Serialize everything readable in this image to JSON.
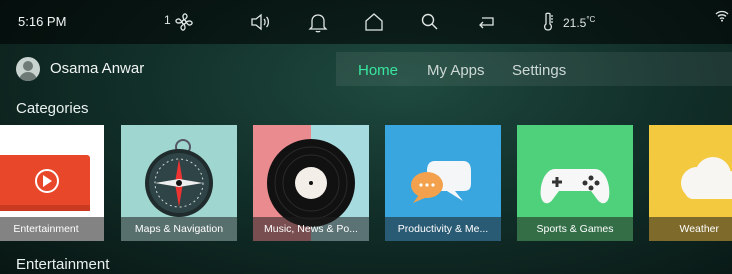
{
  "status_bar": {
    "time": "5:16 PM",
    "fan_level": "1",
    "temperature": "21.5",
    "temperature_unit": "°C",
    "icons": [
      "fan-icon",
      "volume-icon",
      "bell-icon",
      "home-icon",
      "search-icon",
      "return-icon",
      "thermometer-icon",
      "wifi-icon"
    ]
  },
  "user": {
    "name": "Osama  Anwar"
  },
  "nav": {
    "tabs": [
      {
        "label": "Home",
        "active": true
      },
      {
        "label": "My Apps",
        "active": false
      },
      {
        "label": "Settings",
        "active": false
      }
    ]
  },
  "categories": {
    "title": "Categories",
    "items": [
      {
        "label": "Entertainment",
        "bg": "#ffffff",
        "icon": "play-icon"
      },
      {
        "label": "Maps & Navigation",
        "bg": "#9fd6cf",
        "icon": "compass-icon"
      },
      {
        "label": "Music, News & Po...",
        "bg": "#e98b8f",
        "icon": "vinyl-record-icon"
      },
      {
        "label": "Productivity & Me...",
        "bg": "#3aa6e0",
        "icon": "chat-bubbles-icon"
      },
      {
        "label": "Sports & Games",
        "bg": "#4fd07a",
        "icon": "gamepad-icon"
      },
      {
        "label": "Weather",
        "bg": "#f3c93f",
        "icon": "cloud-icon"
      }
    ]
  },
  "entertainment": {
    "title": "Entertainment"
  }
}
